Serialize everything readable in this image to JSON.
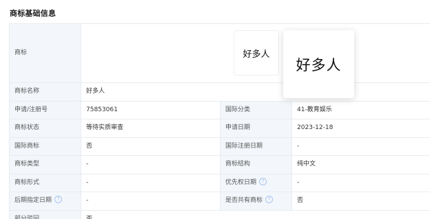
{
  "section": {
    "title": "商标基础信息"
  },
  "icons": {
    "help": "?"
  },
  "logo": {
    "label": "商标",
    "thumb_text": "好多人",
    "preview_text": "好多人"
  },
  "rows": {
    "name": {
      "label": "商标名称",
      "value": "好多人"
    },
    "reg_no": {
      "label": "申请/注册号",
      "value": "75853061"
    },
    "intl_class": {
      "label": "国际分类",
      "value": "41-教育娱乐"
    },
    "status": {
      "label": "商标状态",
      "value": "等待实质审查"
    },
    "apply_date": {
      "label": "申请日期",
      "value": "2023-12-18"
    },
    "intl_mark": {
      "label": "国际商标",
      "value": "否"
    },
    "intl_reg_date": {
      "label": "国际注册日期",
      "value": "-"
    },
    "mark_type": {
      "label": "商标类型",
      "value": "-"
    },
    "structure": {
      "label": "商标结构",
      "value": "纯中文"
    },
    "form": {
      "label": "商标形式",
      "value": "-"
    },
    "priority_date": {
      "label": "优先权日期",
      "value": "-"
    },
    "later_date": {
      "label": "后期指定日期",
      "value": "-"
    },
    "shared": {
      "label": "是否共有商标",
      "value": "否"
    },
    "partial_reject": {
      "label": "部分驳回",
      "value": "否"
    }
  }
}
